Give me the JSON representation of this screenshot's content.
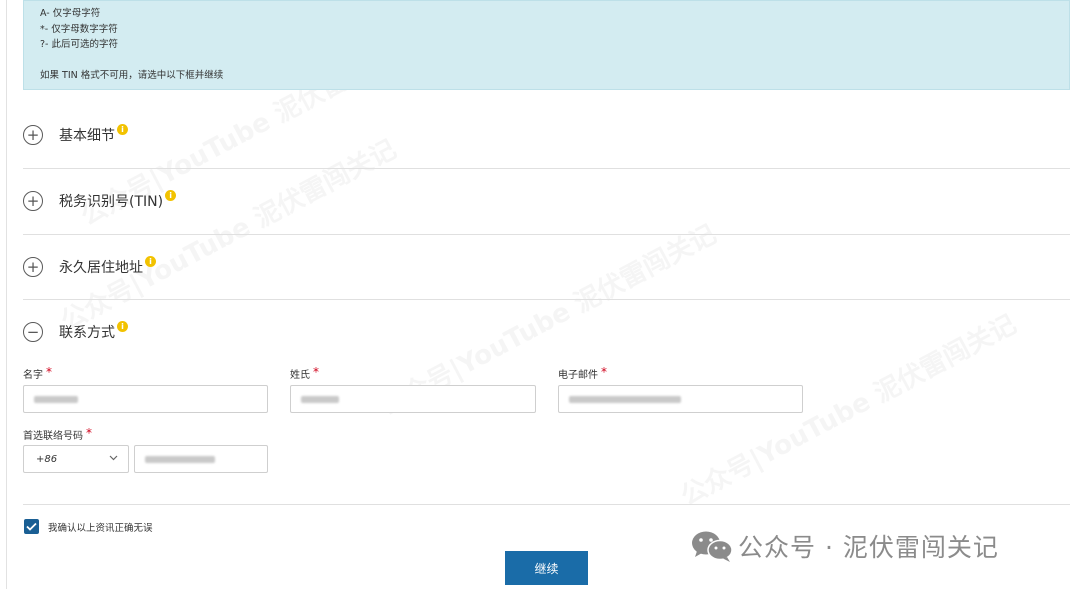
{
  "info_box": {
    "lines": [
      "A- 仅字母字符",
      "*- 仅字母数字字符",
      "?- 此后可选的字符"
    ],
    "note": "如果 TIN 格式不可用，请选中以下框并继续"
  },
  "sections": [
    {
      "title": "基本细节",
      "icon": "plus-circle-icon",
      "info_icon": "i"
    },
    {
      "title": "税务识别号(TIN)",
      "icon": "plus-circle-icon",
      "info_icon": "i"
    },
    {
      "title": "永久居住地址",
      "icon": "plus-circle-icon",
      "info_icon": "i"
    },
    {
      "title": "联系方式",
      "icon": "minus-circle-icon",
      "info_icon": "i"
    }
  ],
  "icons": {
    "plus": "+",
    "minus": "−"
  },
  "contact": {
    "first_name_label": "名字",
    "last_name_label": "姓氏",
    "email_label": "电子邮件",
    "phone_label": "首选联络号码",
    "required_mark": "*",
    "country_code": "+86"
  },
  "confirm_text": "我确认以上资讯正确无误",
  "continue_label": "继续",
  "watermark": {
    "text": "公众号 · 泥伏雷闯关记",
    "diagonal": "公众号|YouTube 泥伏雷闯关记"
  },
  "colors": {
    "info_bg": "#d3ecf1",
    "primary": "#1a6ca8",
    "required": "#d0021b",
    "info_dot": "#f2c200"
  }
}
